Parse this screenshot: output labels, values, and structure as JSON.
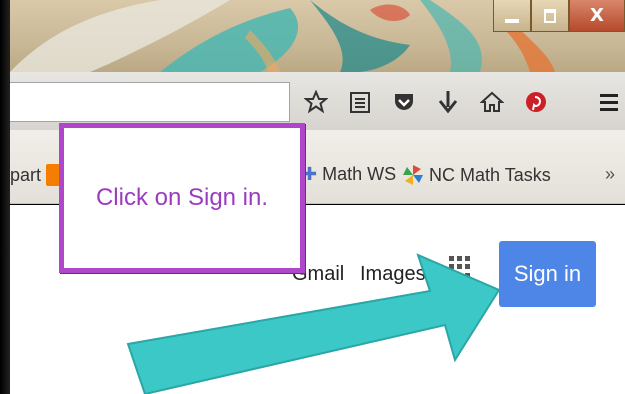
{
  "window": {
    "controls": {
      "minimize_icon": "minimize-icon",
      "restore_icon": "restore-icon",
      "close_label": "X"
    }
  },
  "toolbar": {
    "icons": [
      "star-icon",
      "reading-list-icon",
      "pocket-icon",
      "download-icon",
      "home-icon",
      "pinterest-icon",
      "menu-icon"
    ]
  },
  "bookmarks": {
    "partial_label": "part",
    "items": [
      {
        "label": "Math WS",
        "icon": "puzzle-icon"
      },
      {
        "label": "NC Math Tasks",
        "icon": "pinwheel-icon"
      }
    ],
    "overflow_label": "»"
  },
  "page": {
    "gmail_label": "Gmail",
    "images_label": "Images",
    "signin_label": "Sign in"
  },
  "callout": {
    "text": "Click on Sign in."
  },
  "colors": {
    "callout_border": "#b046c9",
    "callout_text": "#9b3cc0",
    "signin_button": "#4e86e7",
    "arrow": "#3dc8c8"
  }
}
